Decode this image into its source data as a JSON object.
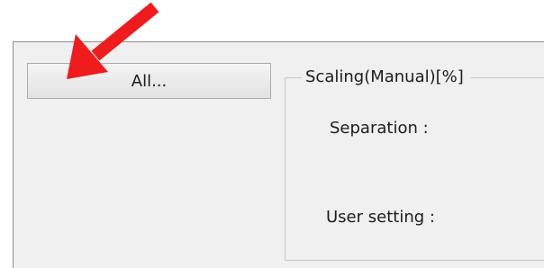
{
  "window": {
    "all_button_label": "All...",
    "group_title": "Scaling(Manual)[%]",
    "separation_label": "Separation :",
    "user_setting_label": "User setting :"
  },
  "annotation": {
    "icon": "red-arrow-icon",
    "color": "#ee1c1c"
  }
}
